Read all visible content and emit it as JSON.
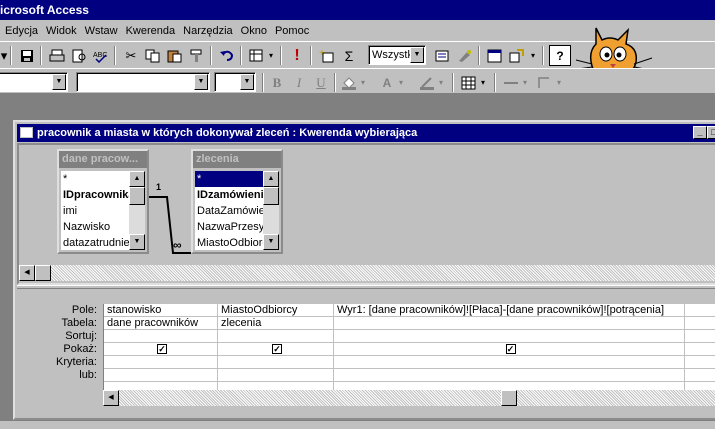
{
  "app": {
    "title": "icrosoft Access"
  },
  "menu": [
    "Edycja",
    "Widok",
    "Wstaw",
    "Kwerenda",
    "Narzędzia",
    "Okno",
    "Pomoc"
  ],
  "toolbar": {
    "view_combo": "Wszystk"
  },
  "query_window": {
    "title": "pracownik a miasta w których dokonywał zleceń : Kwerenda wybierająca"
  },
  "tables": [
    {
      "name": "dane pracow...",
      "fields": [
        "*",
        "IDpracownika",
        "imi",
        "Nazwisko",
        "datazatrudnie"
      ]
    },
    {
      "name": "zlecenia",
      "fields": [
        "*",
        "IDzamówienia",
        "DataZamówien",
        "NazwaPrzesył",
        "MiastoOdbiorc"
      ]
    }
  ],
  "relationship": {
    "one": "1",
    "many": "∞"
  },
  "grid": {
    "row_labels": [
      "Pole:",
      "Tabela:",
      "Sortuj:",
      "Pokaż:",
      "Kryteria:",
      "lub:"
    ],
    "columns": [
      {
        "field": "stanowisko",
        "table": "dane pracowników",
        "sort": "",
        "show": true,
        "criteria": "",
        "or": ""
      },
      {
        "field": "MiastoOdbiorcy",
        "table": "zlecenia",
        "sort": "",
        "show": true,
        "criteria": "",
        "or": ""
      },
      {
        "field": "Wyr1: [dane pracowników]![Płaca]-[dane pracowników]![potrącenia]",
        "table": "",
        "sort": "",
        "show": true,
        "criteria": "",
        "or": ""
      },
      {
        "field": "",
        "table": "",
        "sort": "",
        "show": false,
        "criteria": "",
        "or": ""
      }
    ]
  }
}
